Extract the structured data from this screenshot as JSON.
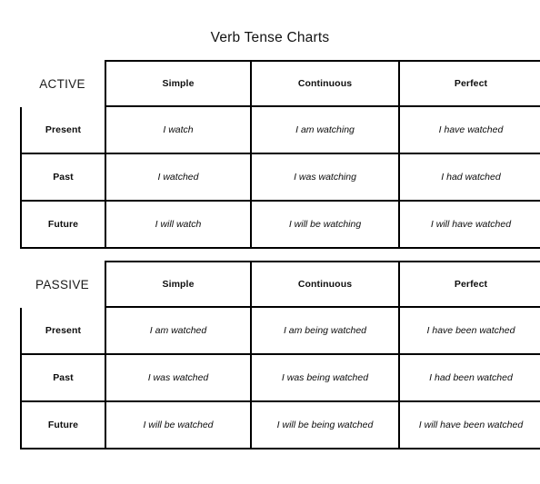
{
  "document": {
    "title": "Verb Tense Charts"
  },
  "colors": {
    "page_background": "#ffffff",
    "text": "#0d0d0d",
    "border": "#000000"
  },
  "charts": [
    {
      "voice_label": "ACTIVE",
      "columns": [
        "Simple",
        "Continuous",
        "Perfect"
      ],
      "rows": [
        {
          "tense": "Present",
          "cells": [
            "I watch",
            "I am watching",
            "I have watched"
          ]
        },
        {
          "tense": "Past",
          "cells": [
            "I watched",
            "I was watching",
            "I had watched"
          ]
        },
        {
          "tense": "Future",
          "cells": [
            "I will watch",
            "I will be watching",
            "I will have watched"
          ]
        }
      ]
    },
    {
      "voice_label": "PASSIVE",
      "columns": [
        "Simple",
        "Continuous",
        "Perfect"
      ],
      "rows": [
        {
          "tense": "Present",
          "cells": [
            "I am watched",
            "I am being watched",
            "I have been watched"
          ]
        },
        {
          "tense": "Past",
          "cells": [
            "I was watched",
            "I was being watched",
            "I had been watched"
          ]
        },
        {
          "tense": "Future",
          "cells": [
            "I will be watched",
            "I will be being watched",
            "I will have been watched"
          ]
        }
      ]
    }
  ]
}
